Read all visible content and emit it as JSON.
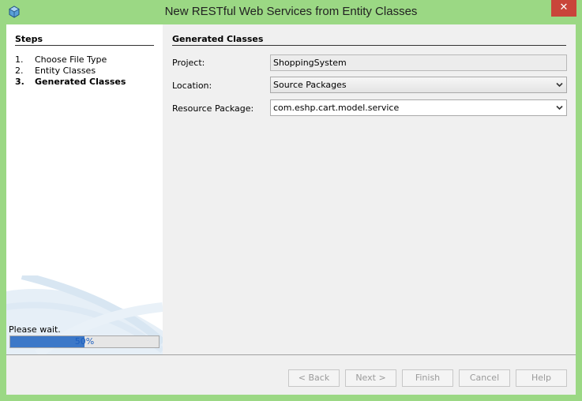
{
  "window": {
    "title": "New RESTful Web Services from Entity Classes",
    "close_glyph": "✕",
    "app_icon": "netbeans-cube-icon"
  },
  "steps": {
    "title": "Steps",
    "items": [
      {
        "num": "1.",
        "label": "Choose File Type",
        "current": false
      },
      {
        "num": "2.",
        "label": "Entity Classes",
        "current": false
      },
      {
        "num": "3.",
        "label": "Generated Classes",
        "current": true
      }
    ]
  },
  "progress": {
    "message": "Please wait.",
    "percent_text": "50%",
    "value": 0.5
  },
  "generated": {
    "title": "Generated Classes",
    "project_label": "Project:",
    "project_value": "ShoppingSystem",
    "location_label": "Location:",
    "location_value": "Source Packages",
    "package_label": "Resource Package:",
    "package_value": "com.eshp.cart.model.service"
  },
  "buttons": {
    "back": "< Back",
    "next": "Next >",
    "finish": "Finish",
    "cancel": "Cancel",
    "help": "Help"
  },
  "colors": {
    "frame": "#9bd884",
    "close": "#c9453a",
    "progress_fill": "#3c78c8"
  }
}
